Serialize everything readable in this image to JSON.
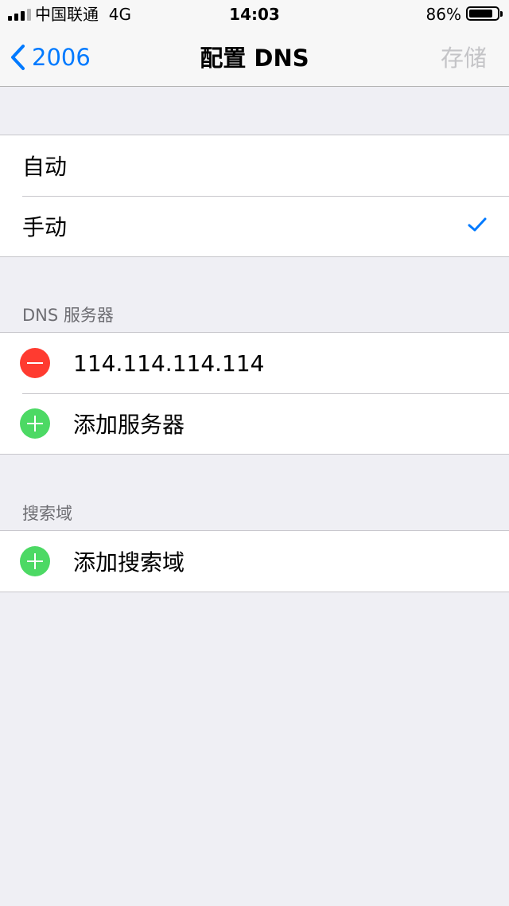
{
  "status_bar": {
    "carrier": "中国联通",
    "network": "4G",
    "time": "14:03",
    "battery_percent": "86%",
    "battery_level": 0.86
  },
  "nav": {
    "back_label": "2006",
    "title": "配置 DNS",
    "save_label": "存储"
  },
  "mode_options": [
    {
      "label": "自动",
      "selected": false
    },
    {
      "label": "手动",
      "selected": true
    }
  ],
  "dns_section": {
    "header": "DNS 服务器",
    "servers": [
      "114.114.114.114"
    ],
    "add_label": "添加服务器"
  },
  "search_section": {
    "header": "搜索域",
    "add_label": "添加搜索域"
  },
  "colors": {
    "accent": "#007aff",
    "delete": "#ff3b30",
    "add": "#4cd964",
    "disabled": "#c4c4c7",
    "background": "#efeff4"
  }
}
